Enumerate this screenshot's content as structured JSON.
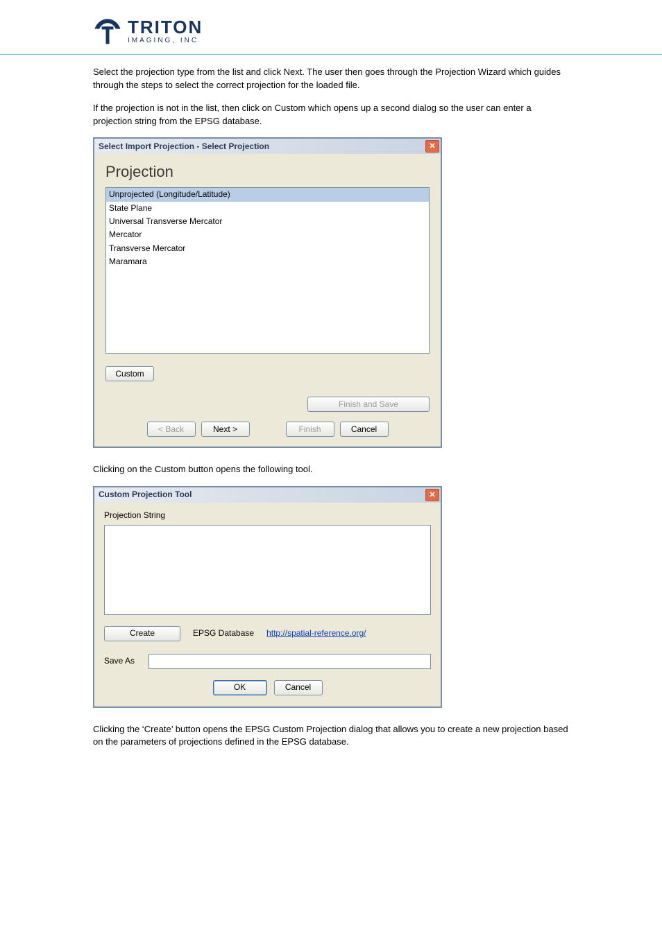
{
  "brand": {
    "name": "TRITON",
    "tagline": "IMAGING, INC"
  },
  "intro": {
    "p1": "Select the projection type from the list and click Next. The user then goes through the Projection Wizard which guides through the steps to select the correct projection for the loaded file.",
    "p2": "If the projection is not in the list, then click on Custom which opens up a second dialog so the user can enter a projection string from the EPSG database."
  },
  "dialog1": {
    "title": "Select Import Projection - Select Projection",
    "heading": "Projection",
    "items": [
      "Unprojected (Longitude/Latitude)",
      "State Plane",
      "Universal Transverse Mercator",
      "Mercator",
      "Transverse Mercator",
      "Maramara"
    ],
    "selectedIndex": 0,
    "custom": "Custom",
    "finishSave": "Finish and Save",
    "back": "< Back",
    "next": "Next >",
    "finish": "Finish",
    "cancel": "Cancel"
  },
  "mid": "Clicking on the Custom button opens the following tool.",
  "dialog2": {
    "title": "Custom Projection Tool",
    "projLabel": "Projection String",
    "create": "Create",
    "epsg": "EPSG Database",
    "link": "http://spatial-reference.org/",
    "saveAs": "Save As",
    "ok": "OK",
    "cancel": "Cancel"
  },
  "outro": "Clicking the ‘Create’ button opens the EPSG Custom Projection dialog that allows you to create a new projection based on the parameters of projections defined in the EPSG database."
}
